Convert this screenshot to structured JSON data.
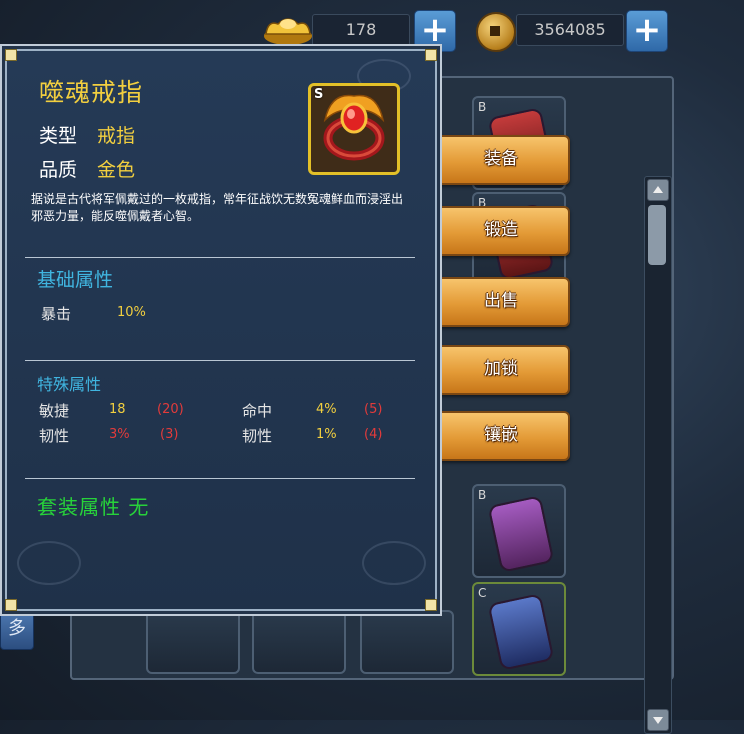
{
  "currency": {
    "ingot_amount": "178",
    "coin_amount": "3564085",
    "plus_label": "+"
  },
  "inventory": {
    "more_label": "多",
    "slot_grades": [
      "B",
      "B",
      "B",
      "C"
    ]
  },
  "actions": [
    {
      "label": "装备"
    },
    {
      "label": "锻造"
    },
    {
      "label": "出售"
    },
    {
      "label": "加锁"
    },
    {
      "label": "镶嵌"
    }
  ],
  "tooltip": {
    "name": "噬魂戒指",
    "type_label": "类型",
    "type_value": "戒指",
    "quality_label": "品质",
    "quality_value": "金色",
    "icon_grade": "S",
    "description": "据说是古代将军佩戴过的一枚戒指，常年征战饮无数冤魂鲜血而浸淫出邪恶力量，能反噬佩戴者心智。",
    "basic_title": "基础属性",
    "basic_stats": [
      {
        "name": "暴击",
        "value": "10%"
      }
    ],
    "special_title": "特殊属性",
    "special_stats": [
      {
        "name": "敏捷",
        "value": "18",
        "range": "(20)",
        "value_color": "#f2cf3f"
      },
      {
        "name": "命中",
        "value": "4%",
        "range": "(5)",
        "value_color": "#f2cf3f"
      },
      {
        "name": "韧性",
        "value": "3%",
        "range": "(3)",
        "value_color": "#e23b3b"
      },
      {
        "name": "韧性",
        "value": "1%",
        "range": "(4)",
        "value_color": "#f2cf3f"
      }
    ],
    "set_text": "套装属性 无"
  }
}
